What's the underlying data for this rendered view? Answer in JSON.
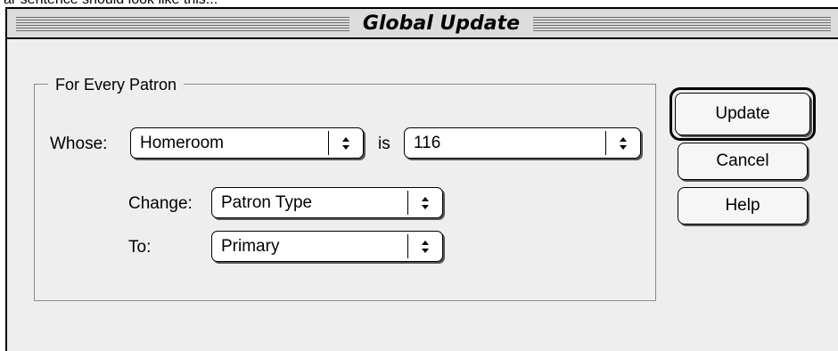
{
  "caption": "ar sentence should look like this...",
  "window": {
    "title": "Global Update"
  },
  "group": {
    "legend": "For Every Patron"
  },
  "criteria": {
    "whose_label": "Whose:",
    "whose_value": "Homeroom",
    "is_label": "is",
    "is_value": "116"
  },
  "change": {
    "change_label": "Change:",
    "change_value": "Patron Type",
    "to_label": "To:",
    "to_value": "Primary"
  },
  "buttons": {
    "update": "Update",
    "cancel": "Cancel",
    "help": "Help"
  },
  "icons": {
    "popup_arrows": "up-down-arrows-icon"
  }
}
